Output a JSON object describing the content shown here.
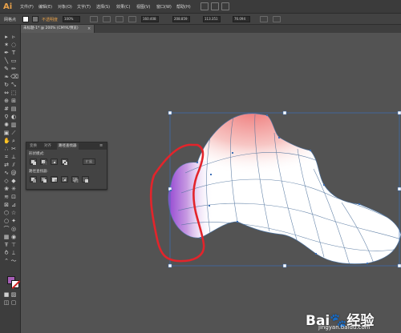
{
  "app": {
    "logo": "Ai",
    "menus": [
      "文件(F)",
      "编辑(E)",
      "对象(O)",
      "文字(T)",
      "选择(S)",
      "效果(C)",
      "视图(V)",
      "窗口(W)",
      "帮助(H)"
    ]
  },
  "controlbar": {
    "object_label": "网格点",
    "stroke_label": "描边:",
    "opacity_label": "不透明度",
    "opacity_value": "100%",
    "x_value": "160.408",
    "y_value": "208.859",
    "w_value": "113.351",
    "h_value": "76.094"
  },
  "document": {
    "tab_title": "未标题-1* @ 200% (CMYK/预览)",
    "close": "×"
  },
  "pathfinder_panel": {
    "tabs": [
      "变换",
      "对齐",
      "路径查找器"
    ],
    "active_tab": "路径查找器",
    "shape_modes_label": "形状模式:",
    "pathfinders_label": "路径查找器:",
    "expand_label": "扩展"
  },
  "tools": {
    "fill_color": "#a55eb5",
    "stroke_color": "#ffffff"
  },
  "watermark": {
    "logo_text": "Bai🐾经验",
    "url": "jingyan.baidu.com"
  }
}
